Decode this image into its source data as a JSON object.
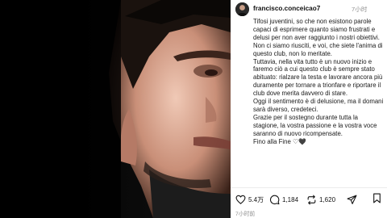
{
  "post": {
    "username": "francisco.conceicao7",
    "time": "7小时",
    "caption_paragraphs": [
      "Tifosi juventini, so che non esistono parole capaci di esprimere quanto siamo frustrati e delusi per non aver raggiunto i nostri obiettivi.",
      "Non ci siamo riusciti, e voi, che siete l'anima di questo club, non lo meritate.",
      "Tuttavia, nella vita tutto è un nuovo inizio e faremo ciò a cui questo club è sempre stato abituato: rialzare la testa e lavorare ancora più duramente per tornare a trionfare e riportare il club dove merita davvero di stare.",
      "Oggi il sentimento è di delusione, ma il domani sarà diverso, credeteci.",
      "Grazie per il sostegno durante tutta la stagione, la vostra passione e la vostra voce saranno di nuovo ricompensate.",
      "Fino alla Fine"
    ],
    "caption_end_glyphs": "♡🖤"
  },
  "actions": {
    "likes": "5.4万",
    "comments": "1,184",
    "reposts": "1,620"
  },
  "footer": {
    "timestamp": "7小时前"
  },
  "icons": [
    "heart-icon",
    "comment-icon",
    "repost-icon",
    "share-icon",
    "bookmark-icon"
  ]
}
